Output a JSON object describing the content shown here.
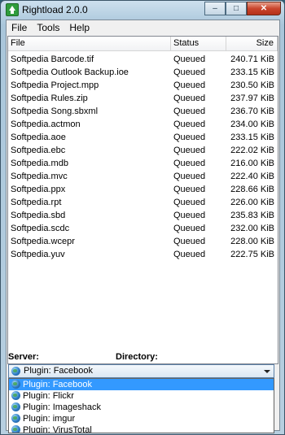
{
  "window": {
    "title": "Rightload 2.0.0"
  },
  "window_buttons": {
    "minimize": "–",
    "maximize": "□",
    "close": "✕"
  },
  "menu": [
    "File",
    "Tools",
    "Help"
  ],
  "list": {
    "headers": {
      "file": "File",
      "status": "Status",
      "size": "Size"
    },
    "rows": [
      {
        "file": "Softpedia Barcode.tif",
        "status": "Queued",
        "size": "240.71 KiB"
      },
      {
        "file": "Softpedia Outlook Backup.ioe",
        "status": "Queued",
        "size": "233.15 KiB"
      },
      {
        "file": "Softpedia Project.mpp",
        "status": "Queued",
        "size": "230.50 KiB"
      },
      {
        "file": "Softpedia Rules.zip",
        "status": "Queued",
        "size": "237.97 KiB"
      },
      {
        "file": "Softpedia Song.sbxml",
        "status": "Queued",
        "size": "236.70 KiB"
      },
      {
        "file": "Softpedia.actmon",
        "status": "Queued",
        "size": "234.00 KiB"
      },
      {
        "file": "Softpedia.aoe",
        "status": "Queued",
        "size": "233.15 KiB"
      },
      {
        "file": "Softpedia.ebc",
        "status": "Queued",
        "size": "222.02 KiB"
      },
      {
        "file": "Softpedia.mdb",
        "status": "Queued",
        "size": "216.00 KiB"
      },
      {
        "file": "Softpedia.mvc",
        "status": "Queued",
        "size": "222.40 KiB"
      },
      {
        "file": "Softpedia.ppx",
        "status": "Queued",
        "size": "228.66 KiB"
      },
      {
        "file": "Softpedia.rpt",
        "status": "Queued",
        "size": "226.00 KiB"
      },
      {
        "file": "Softpedia.sbd",
        "status": "Queued",
        "size": "235.83 KiB"
      },
      {
        "file": "Softpedia.scdc",
        "status": "Queued",
        "size": "232.00 KiB"
      },
      {
        "file": "Softpedia.wcepr",
        "status": "Queued",
        "size": "228.00 KiB"
      },
      {
        "file": "Softpedia.yuv",
        "status": "Queued",
        "size": "222.75 KiB"
      }
    ]
  },
  "labels": {
    "server": "Server:",
    "directory": "Directory:"
  },
  "server_select": {
    "value": "Plugin: Facebook",
    "options": [
      "Plugin: Facebook",
      "Plugin: Flickr",
      "Plugin: Imageshack",
      "Plugin: imgur",
      "Plugin: VirusTotal"
    ],
    "highlighted": 0
  },
  "colors": {
    "selection": "#3399ff",
    "close_button": "#c9452c",
    "app_icon": "#2f9c3c"
  }
}
